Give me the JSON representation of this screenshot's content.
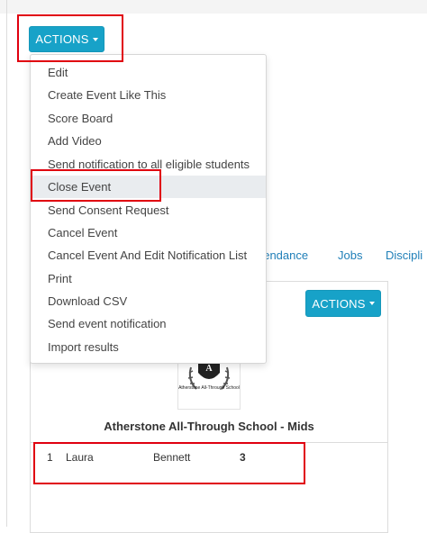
{
  "actions_label": "ACTIONS",
  "menu": {
    "items": [
      {
        "label": "Edit"
      },
      {
        "label": "Create Event Like This"
      },
      {
        "label": "Score Board"
      },
      {
        "label": "Add Video"
      },
      {
        "label": "Send notification to all eligible students"
      },
      {
        "label": "Close Event",
        "highlighted": true
      },
      {
        "label": "Send Consent Request"
      },
      {
        "label": "Cancel Event"
      },
      {
        "label": "Cancel Event And Edit Notification List"
      },
      {
        "label": "Print"
      },
      {
        "label": "Download CSV"
      },
      {
        "label": "Send event notification"
      },
      {
        "label": "Import results"
      }
    ]
  },
  "tabs": {
    "attendance": "ttendance",
    "jobs": "Jobs",
    "discipline": "Discipli"
  },
  "team": {
    "actions_label": "ACTIONS",
    "logo_text": "Atherstone All-Through School",
    "school_name": "Atherstone All-Through School - Mids"
  },
  "row": {
    "rank": "1",
    "first_name": "Laura",
    "last_name": "Bennett",
    "score": "3"
  },
  "colors": {
    "accent": "#17a2c8",
    "highlight_box": "#e0000f",
    "link": "#1f7fb8"
  }
}
